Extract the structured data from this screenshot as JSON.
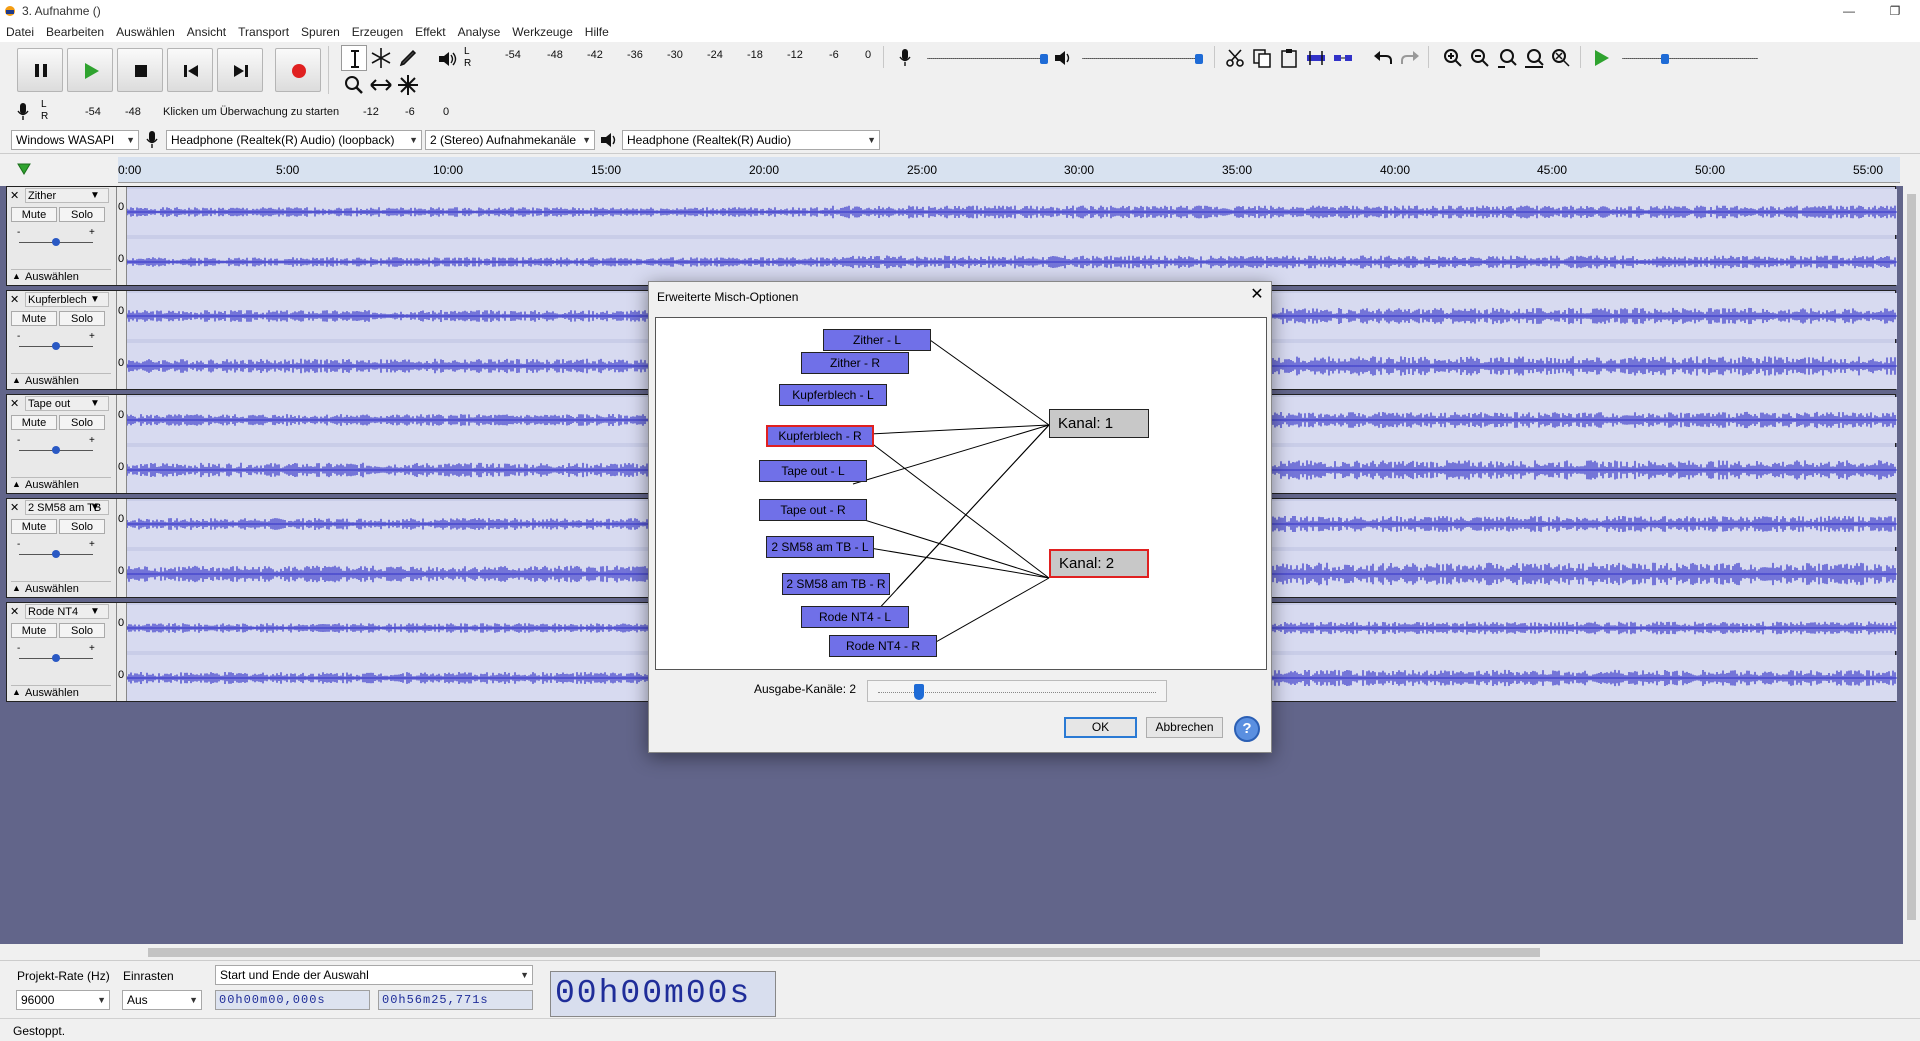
{
  "window": {
    "title": "3. Aufnahme ()"
  },
  "menu": [
    "Datei",
    "Bearbeiten",
    "Auswählen",
    "Ansicht",
    "Transport",
    "Spuren",
    "Erzeugen",
    "Effekt",
    "Analyse",
    "Werkzeuge",
    "Hilfe"
  ],
  "meters": {
    "playback_scale": [
      "-54",
      "-48",
      "-42",
      "-36",
      "-30",
      "-24",
      "-18",
      "-12",
      "-6",
      "0"
    ],
    "record_scale": [
      "-54",
      "-48",
      "-12",
      "-6",
      "0"
    ],
    "record_hint": "Klicken um Überwachung zu starten",
    "lr_l": "L",
    "lr_r": "R"
  },
  "device_toolbar": {
    "host": "Windows WASAPI",
    "recording_device": "Headphone (Realtek(R) Audio) (loopback)",
    "channels": "2 (Stereo) Aufnahmekanäle",
    "playback_device": "Headphone (Realtek(R) Audio)"
  },
  "ruler": [
    "0:00",
    "5:00",
    "10:00",
    "15:00",
    "20:00",
    "25:00",
    "30:00",
    "35:00",
    "40:00",
    "45:00",
    "50:00",
    "55:00"
  ],
  "track_controls": {
    "mute": "Mute",
    "solo": "Solo",
    "select": "Auswählen",
    "zero": "0",
    "minus": "-",
    "plus": "+"
  },
  "tracks": [
    {
      "name": "Zither"
    },
    {
      "name": "Kupferblech"
    },
    {
      "name": "Tape out"
    },
    {
      "name": "2 SM58 am TB"
    },
    {
      "name": "Rode NT4"
    }
  ],
  "dialog": {
    "title": "Erweiterte Misch-Optionen",
    "sources": [
      "Zither - L",
      "Zither - R",
      "Kupferblech - L",
      "Kupferblech - R",
      "Tape out - L",
      "Tape out - R",
      "2 SM58 am TB - L",
      "2 SM58 am TB - R",
      "Rode NT4 - L",
      "Rode NT4 - R"
    ],
    "selected_source": "Kupferblech - R",
    "channels": [
      "Kanal:  1",
      "Kanal:  2"
    ],
    "selected_channel": "Kanal:  2",
    "output_label": "Ausgabe-Kanäle:  2",
    "output_channels": 2,
    "ok": "OK",
    "cancel": "Abbrechen",
    "help": "?"
  },
  "selection_bar": {
    "rate_label": "Projekt-Rate (Hz)",
    "rate_value": "96000",
    "snap_label": "Einrasten",
    "snap_value": "Aus",
    "mode": "Start und Ende der Auswahl",
    "start_time": "00h00m00,000s",
    "end_time": "00h56m25,771s",
    "audio_position": "00h00m00s"
  },
  "status": "Gestoppt.",
  "colors": {
    "wave": "#3232c8",
    "track_bg": "#62658a",
    "source_box": "#7070e8",
    "selection_border": "#e02020"
  }
}
